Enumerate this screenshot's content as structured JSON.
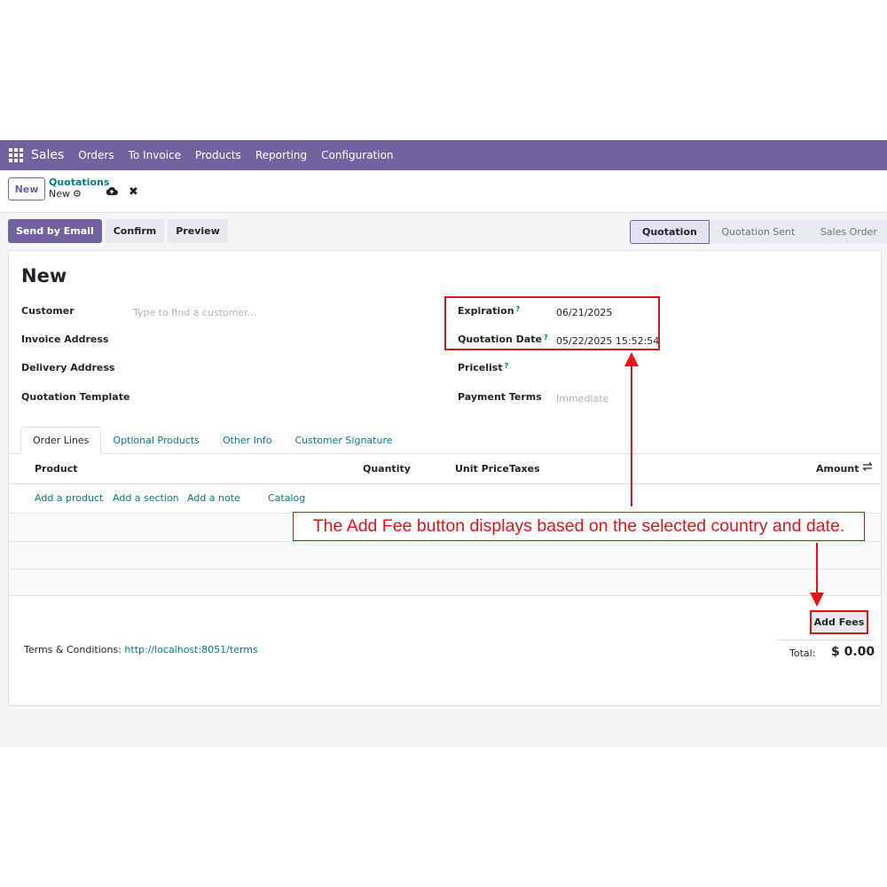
{
  "navbar": {
    "app_name": "Sales",
    "menu": [
      "Orders",
      "To Invoice",
      "Products",
      "Reporting",
      "Configuration"
    ]
  },
  "control_panel": {
    "new_button": "New",
    "breadcrumb_parent": "Quotations",
    "breadcrumb_current": "New"
  },
  "actions": {
    "send_by_email": "Send by Email",
    "confirm": "Confirm",
    "preview": "Preview"
  },
  "statusbar": {
    "stages": [
      "Quotation",
      "Quotation Sent",
      "Sales Order"
    ],
    "active": "Quotation"
  },
  "form": {
    "title": "New",
    "customer_label": "Customer",
    "customer_placeholder": "Type to find a customer...",
    "invoice_address_label": "Invoice Address",
    "delivery_address_label": "Delivery Address",
    "quotation_template_label": "Quotation Template",
    "expiration_label": "Expiration",
    "expiration_value": "06/21/2025",
    "quotation_date_label": "Quotation Date",
    "quotation_date_value": "05/22/2025 15:52:54",
    "pricelist_label": "Pricelist",
    "payment_terms_label": "Payment Terms",
    "payment_terms_placeholder": "Immediate",
    "help_mark": "?"
  },
  "tabs": [
    "Order Lines",
    "Optional Products",
    "Other Info",
    "Customer Signature"
  ],
  "order_lines": {
    "columns": {
      "product": "Product",
      "quantity": "Quantity",
      "unit_price": "Unit Price",
      "taxes": "Taxes",
      "amount": "Amount"
    },
    "add_links": [
      "Add a product",
      "Add a section",
      "Add a note",
      "Catalog"
    ]
  },
  "footer": {
    "terms_label": "Terms & Conditions:",
    "terms_link": "http://localhost:8051/terms",
    "add_fees_button": "Add Fees",
    "total_label": "Total:",
    "total_value": "$ 0.00"
  },
  "annotation": {
    "text": "The Add Fee button displays based on the selected country and date.",
    "color": "#e1141a"
  },
  "colors": {
    "brand": "#71639e",
    "link": "#017e84"
  }
}
